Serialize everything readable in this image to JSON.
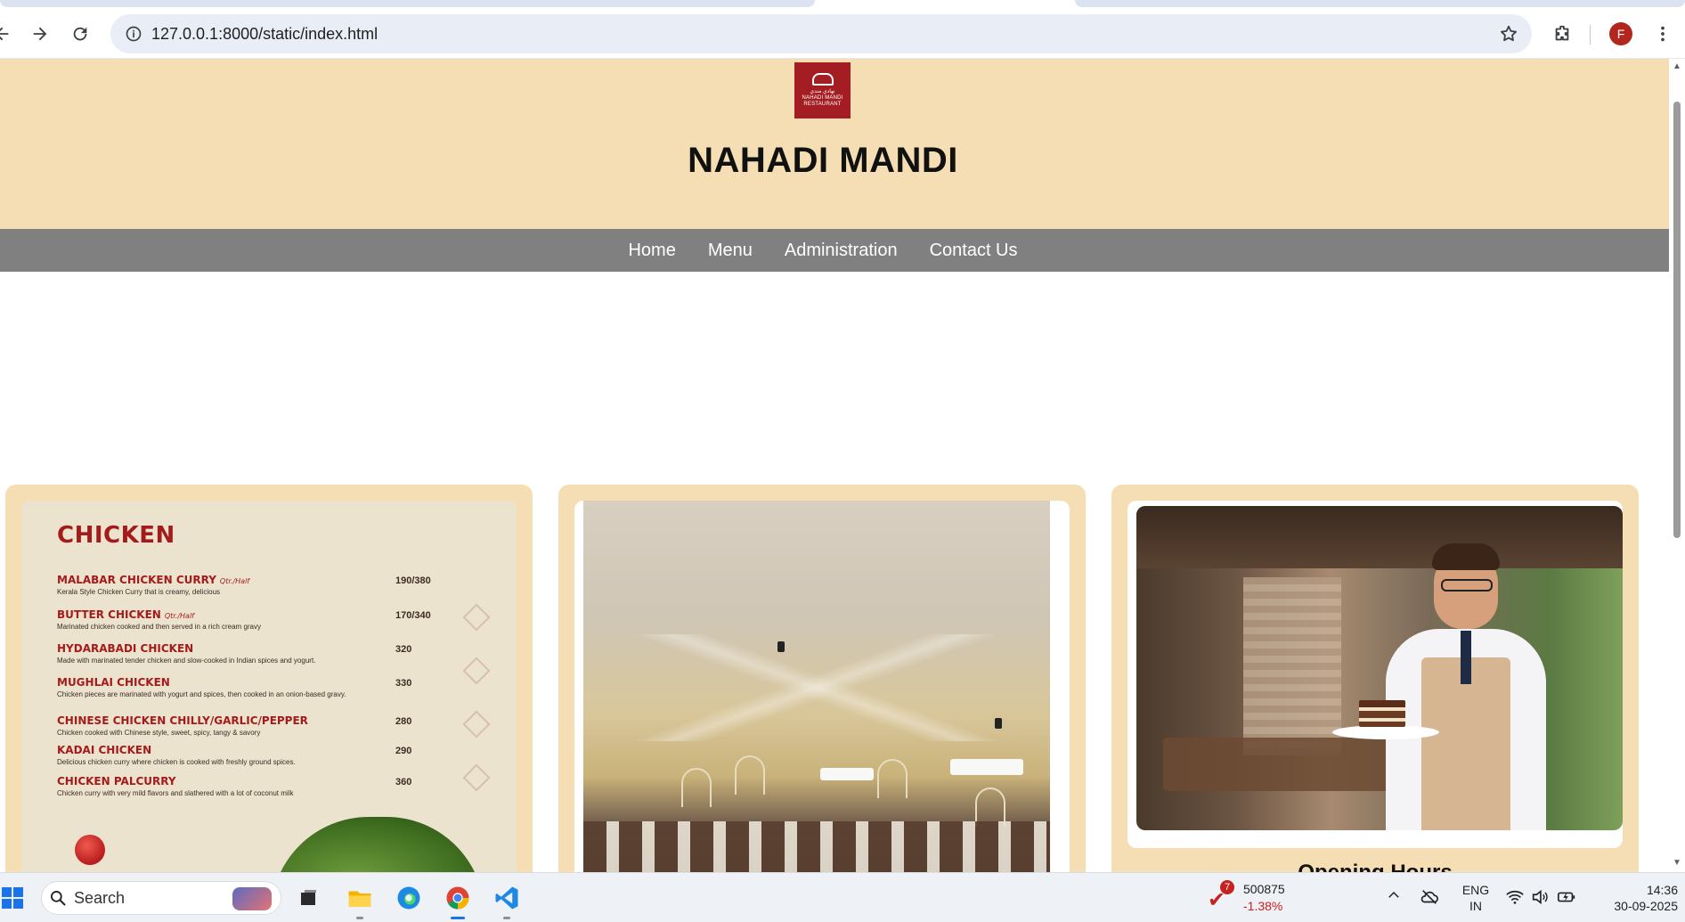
{
  "browser": {
    "url": "127.0.0.1:8000/static/index.html",
    "profile_initial": "F"
  },
  "site": {
    "title": "NAHADI MANDI",
    "logo_text_top": "نهادي مندي",
    "logo_text_mid": "NAHADI MANDI",
    "logo_text_bottom": "RESTAURANT",
    "nav": [
      {
        "label": "Home"
      },
      {
        "label": "Menu"
      },
      {
        "label": "Administration"
      },
      {
        "label": "Contact Us"
      }
    ]
  },
  "menu_card": {
    "heading": "CHICKEN",
    "items": [
      {
        "name": "MALABAR CHICKEN CURRY",
        "size": "Qtr./Half",
        "desc": "Kerala Style Chicken Curry that is creamy, delicious",
        "price": "190/380"
      },
      {
        "name": "BUTTER CHICKEN",
        "size": "Qtr./Half",
        "desc": "Marinated chicken cooked and then served in a rich cream gravy",
        "price": "170/340"
      },
      {
        "name": "HYDARABADI CHICKEN",
        "size": "",
        "desc": "Made with marinated tender chicken and slow-cooked in Indian spices and yogurt.",
        "price": "320"
      },
      {
        "name": "MUGHLAI CHICKEN",
        "size": "",
        "desc": "Chicken pieces are marinated with yogurt and spices, then cooked in an onion-based gravy.",
        "price": "330"
      },
      {
        "name": "CHINESE CHICKEN CHILLY/GARLIC/PEPPER",
        "size": "",
        "desc": "Chicken cooked with Chinese style, sweet, spicy, tangy & savory",
        "price": "280"
      },
      {
        "name": "KADAI CHICKEN",
        "size": "",
        "desc": "Delicious chicken curry where chicken is cooked with freshly ground spices.",
        "price": "290"
      },
      {
        "name": "CHICKEN PALCURRY",
        "size": "",
        "desc": "Chicken curry with very mild flavors and slathered with a lot of coconut milk",
        "price": "360"
      }
    ]
  },
  "third_card": {
    "caption": "Opening Hours"
  },
  "taskbar": {
    "search_placeholder": "Search",
    "stock_badge": "7",
    "stock_value": "500875",
    "stock_change": "-1.38%",
    "lang_top": "ENG",
    "lang_bottom": "IN",
    "time": "14:36",
    "date": "30-09-2025"
  }
}
